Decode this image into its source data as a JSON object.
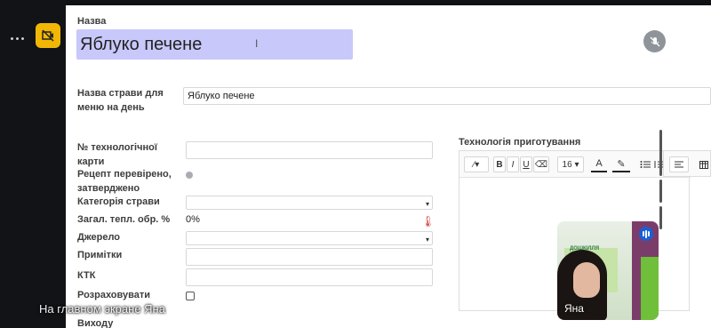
{
  "form": {
    "title_label": "Назва",
    "title_value": "Яблуко печене",
    "menu_name_label": "Назва страви для меню на день",
    "menu_name_value": "Яблуко печене",
    "tech_card_label": "№ технологічної карти",
    "tech_card_value": "",
    "recipe_checked_label": "Рецепт перевірено, затверджено",
    "category_label": "Категорія страви",
    "category_value": "",
    "heat_loss_label": "Загал. тепл. обр. %",
    "heat_loss_value": "0%",
    "source_label": "Джерело",
    "source_value": "",
    "notes_label": "Примітки",
    "notes_value": "",
    "ktk_label": "КТК",
    "ktk_value": "",
    "calc_output_label_1": "Розраховувати",
    "calc_output_label_2": "Виходу"
  },
  "editor": {
    "label": "Технологія приготування",
    "toolbar": {
      "magic": "⁄▾",
      "bold": "B",
      "italic": "I",
      "underline": "U",
      "eraser": "⌫",
      "font_size": "16",
      "font_size_caret": "▾",
      "text_color": "A",
      "highlight": "✎"
    }
  },
  "video": {
    "participant_name": "Яна",
    "banner_text": "ДОШКІЛЛЯ ЛЮДИНА ПОЧИНАЄ"
  },
  "caption": "На главном экране Яна",
  "colors": {
    "title_highlight": "#c8c8fb",
    "app_icon": "#f2b705",
    "speaker_badge": "#1a5fd6"
  }
}
